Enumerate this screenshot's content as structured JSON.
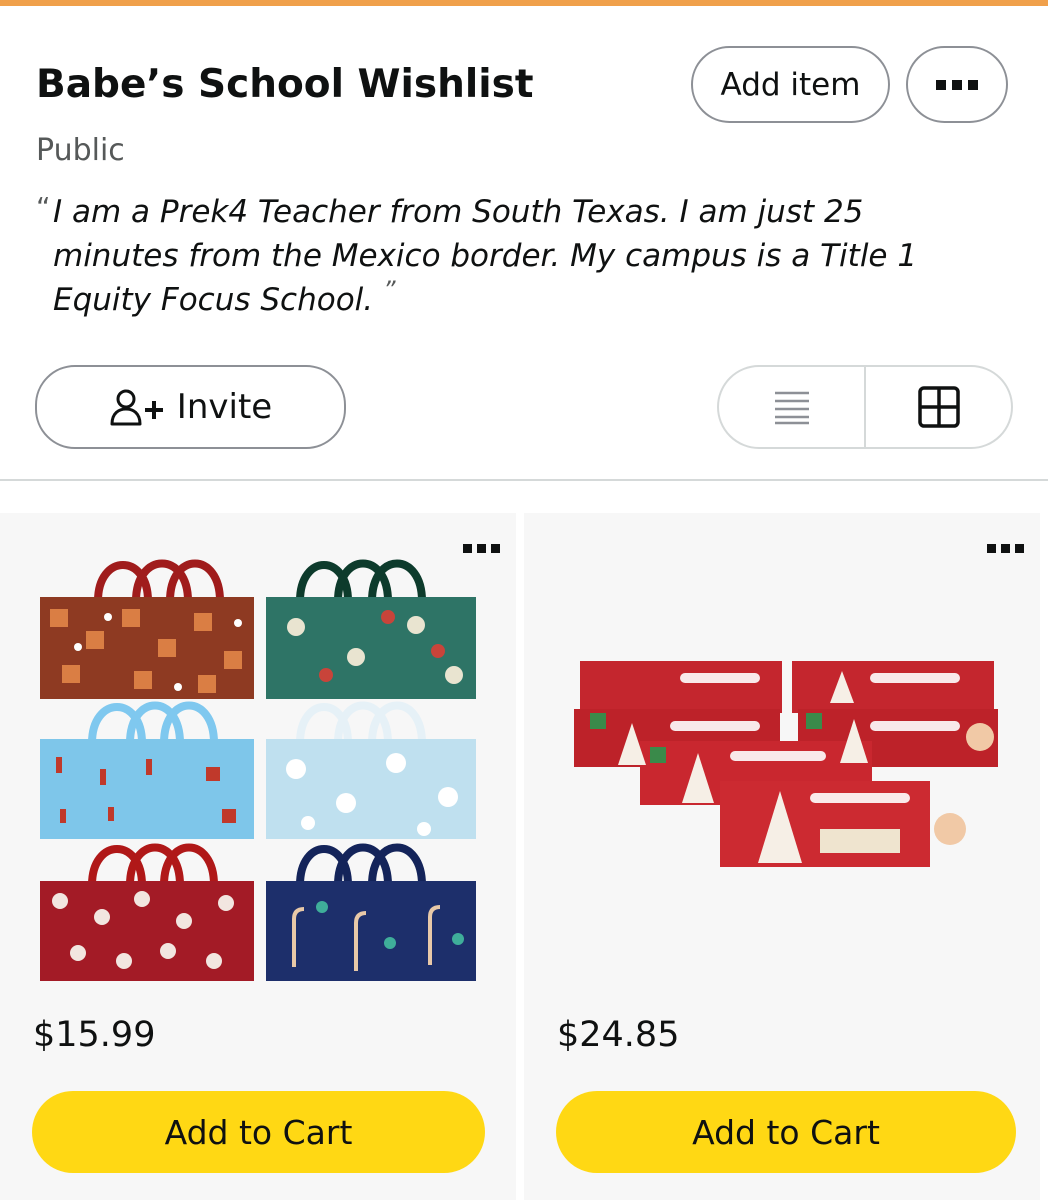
{
  "header": {
    "title": "Babe’s School Wishlist",
    "privacy": "Public",
    "add_item_label": "Add item",
    "more_icon": "more-horizontal-icon"
  },
  "description": {
    "open_quote": "“",
    "text": "I am a Prek4 Teacher from South Texas. I am just 25 minutes from the Mexico border. My campus is a Title 1 Equity Focus School.",
    "close_quote": "”"
  },
  "actions": {
    "invite_label": "Invite",
    "invite_icon": "add-person-icon",
    "view_options": [
      {
        "icon": "list-view-icon"
      },
      {
        "icon": "grid-view-icon",
        "selected": true
      }
    ]
  },
  "items": [
    {
      "image": "christmas-gift-bags-set",
      "price": "$15.99",
      "cart_label": "Add to Cart"
    },
    {
      "image": "little-debbie-christmas-tree-cakes",
      "price": "$24.85",
      "cart_label": "Add to Cart"
    }
  ],
  "colors": {
    "accent": "#f0a04b",
    "cart_button": "#ffd814",
    "card_bg": "#f7f7f7",
    "text": "#0f1111",
    "muted": "#565959"
  }
}
